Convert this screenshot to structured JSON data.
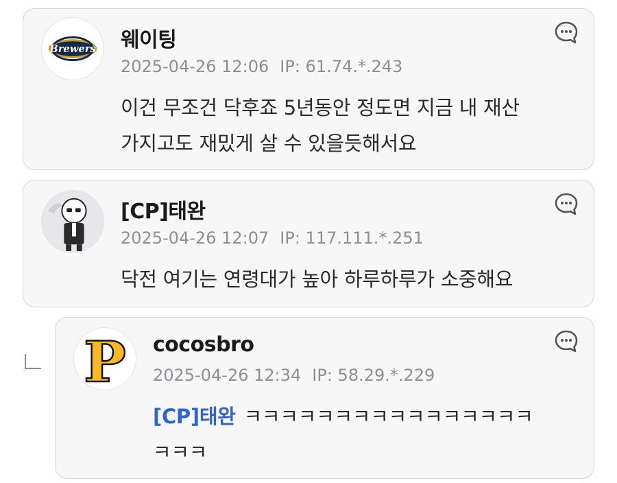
{
  "comments": [
    {
      "author": "웨이팅",
      "date": "2025-04-26 12:06",
      "ip": "IP: 61.74.*.243",
      "lines": [
        "이건 무조건 닥후죠 5년동안 정도면 지금 내 재산",
        "가지고도 재밌게 살 수 있을듯해서요"
      ],
      "avatar_icon": "brewers-logo-icon",
      "avatar_text": "Brewers"
    },
    {
      "author": "[CP]태완",
      "date": "2025-04-26 12:07",
      "ip": "IP: 117.111.*.251",
      "lines": [
        "닥전 여기는 연령대가 높아 하루하루가 소중해요"
      ],
      "avatar_icon": "character-avatar-icon"
    },
    {
      "author": "cocosbro",
      "date": "2025-04-26 12:34",
      "ip": "IP: 58.29.*.229",
      "mention": "[CP]태완",
      "lines": [
        "ㅋㅋㅋㅋㅋㅋㅋㅋㅋㅋㅋㅋㅋㅋㅋㅋ",
        "ㅋㅋㅋ"
      ],
      "avatar_icon": "pirates-p-logo-icon",
      "avatar_text": "P"
    }
  ],
  "icons": {
    "reply": "comment-bubble-icon",
    "reply_indicator": "reply-arrow-icon"
  },
  "colors": {
    "mention": "#2f66c7",
    "card_bg": "#f7f7f8",
    "meta_text": "#8e8e93"
  }
}
